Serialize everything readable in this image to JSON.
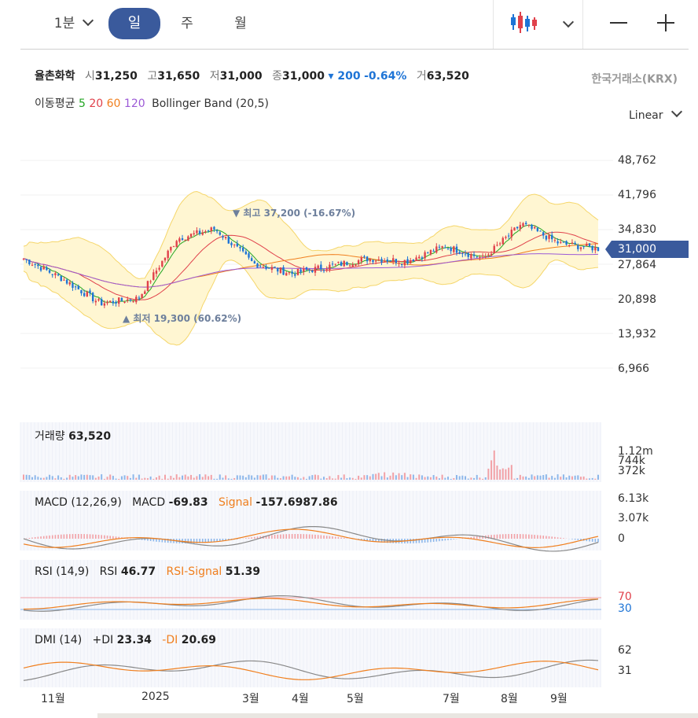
{
  "topbar": {
    "tabs": [
      {
        "label": "1분"
      },
      {
        "label": "일"
      },
      {
        "label": "주"
      },
      {
        "label": "월"
      }
    ],
    "active_tab": "일",
    "chart_type_icon": "candlestick-icon",
    "minimize_icon": "minus-icon",
    "add_icon": "plus-icon"
  },
  "stock": {
    "name": "율촌화학",
    "open_label": "시",
    "open": "31,250",
    "high_label": "고",
    "high": "31,650",
    "low_label": "저",
    "low": "31,000",
    "close_label": "종",
    "close": "31,000",
    "change": "▾ 200",
    "change_pct": "-0.64%",
    "volume_label": "거",
    "volume": "63,520",
    "exchange": "한국거래소(KRX)"
  },
  "indicators": {
    "ma_label": "이동평균",
    "ma5": "5",
    "ma20": "20",
    "ma60": "60",
    "ma120": "120",
    "bb_label": "Bollinger Band (20,5)"
  },
  "scale_mode": "Linear",
  "colors": {
    "accent": "#3a5a9c",
    "up": "#e0414b",
    "down": "#1e74d6",
    "ma5": "#23a623",
    "ma20": "#e0414b",
    "ma60": "#f07f1e",
    "ma120": "#9c5ad6",
    "band_fill": "#fff6d2",
    "band_line": "#f5d66a"
  },
  "price_axis": [
    "48,762",
    "41,796",
    "34,830",
    "27,864",
    "20,898",
    "13,932",
    "6,966"
  ],
  "current_price_tag": "31,000",
  "annotations": {
    "high": "▼ 최고 37,200 (-16.67%)",
    "low": "▲ 최저 19,300 (60.62%)"
  },
  "volume_panel": {
    "title": "거래량",
    "value": "63,520",
    "axis": [
      "1.12m",
      "744k",
      "372k"
    ]
  },
  "macd_panel": {
    "title": "MACD (12,26,9)",
    "macd_label": "MACD",
    "macd_value": "-69.83",
    "signal_label": "Signal",
    "signal_value": "-157.6987.86",
    "axis": [
      "6.13k",
      "3.07k",
      "0"
    ]
  },
  "rsi_panel": {
    "title": "RSI (14,9)",
    "rsi_label": "RSI",
    "rsi_value": "46.77",
    "signal_label": "RSI-Signal",
    "signal_value": "51.39",
    "axis_hi": "70",
    "axis_lo": "30"
  },
  "dmi_panel": {
    "title": "DMI (14)",
    "pdi_label": "+DI",
    "pdi_value": "23.34",
    "mdi_label": "-DI",
    "mdi_value": "20.69",
    "axis": [
      "62",
      "31"
    ]
  },
  "x_axis": [
    "11월",
    "2025",
    "3월",
    "4월",
    "5월",
    "7월",
    "8월",
    "9월"
  ],
  "chart_data": {
    "type": "line",
    "title": "",
    "x": [
      "11월",
      "2025",
      "3월",
      "4월",
      "5월",
      "7월",
      "8월",
      "9월"
    ],
    "ylim": [
      6966,
      48762
    ],
    "series": [
      {
        "values": [
          29000,
          25000,
          20000,
          21000,
          33000,
          35000,
          28000,
          26000,
          27500,
          29000,
          28500,
          31500,
          29000,
          36000,
          32000,
          31000
        ]
      }
    ]
  }
}
